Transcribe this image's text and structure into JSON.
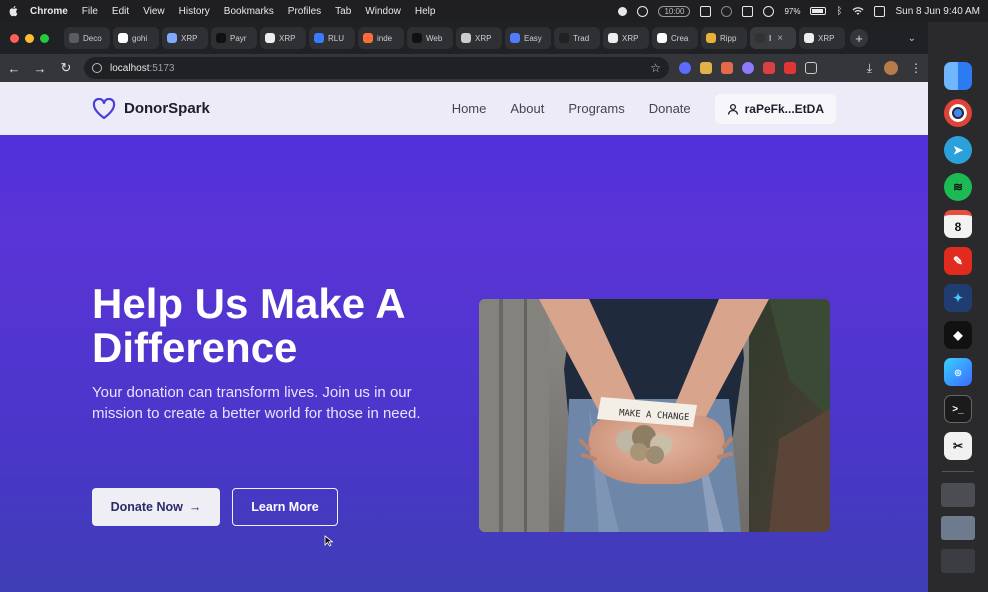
{
  "menubar": {
    "app_name": "Chrome",
    "menus": [
      "File",
      "Edit",
      "View",
      "History",
      "Bookmarks",
      "Profiles",
      "Tab",
      "Window",
      "Help"
    ],
    "timer_label": "10:00",
    "battery": "97%",
    "datetime": "Sun 8 Jun  9:40 AM"
  },
  "browser": {
    "tabs": [
      {
        "label": "Deco",
        "fav_color": "#5b5c60"
      },
      {
        "label": "gohi",
        "fav_color": "#ffffff"
      },
      {
        "label": "XRP",
        "fav_color": "#7fa8ff"
      },
      {
        "label": "Payr",
        "fav_color": "#111111"
      },
      {
        "label": "XRP",
        "fav_color": "#eeeeee"
      },
      {
        "label": "RLU",
        "fav_color": "#3a7bff"
      },
      {
        "label": "inde",
        "fav_color": "#ff6a3d"
      },
      {
        "label": "Web",
        "fav_color": "#111111"
      },
      {
        "label": "XRP",
        "fav_color": "#cccccc"
      },
      {
        "label": "Easy",
        "fav_color": "#4f7bff"
      },
      {
        "label": "Trad",
        "fav_color": "#222222"
      },
      {
        "label": "XRP",
        "fav_color": "#eeeeee"
      },
      {
        "label": "Crea",
        "fav_color": "#ffffff"
      },
      {
        "label": "Ripp",
        "fav_color": "#e8b13a"
      },
      {
        "label": "I",
        "fav_color": "#333333"
      },
      {
        "label": "XRP",
        "fav_color": "#eeeeee"
      }
    ],
    "url_host": "localhost",
    "url_port": ":5173"
  },
  "site": {
    "brand": "DonorSpark",
    "nav": [
      "Home",
      "About",
      "Programs",
      "Donate"
    ],
    "wallet": "raPeFk...EtDA",
    "hero_title": "Help Us Make A Difference",
    "hero_sub": "Your donation can transform lives. Join us in our mission to create a better world for those in need.",
    "donate_btn": "Donate Now",
    "learn_btn": "Learn More",
    "photo_sign": "MAKE A CHANGE"
  },
  "dock": {
    "calendar_day": "8",
    "apps": [
      "finder",
      "chrome",
      "telegram",
      "spotify",
      "calendar",
      "acrobat",
      "app-m",
      "box-app",
      "cleanmymac",
      "terminal",
      "capcut"
    ]
  },
  "colors": {
    "hero_top": "#4a2fdc",
    "hero_bottom": "#3f3db6",
    "nav_bg": "#ecebf7",
    "brand_accent": "#4b3fd8"
  }
}
